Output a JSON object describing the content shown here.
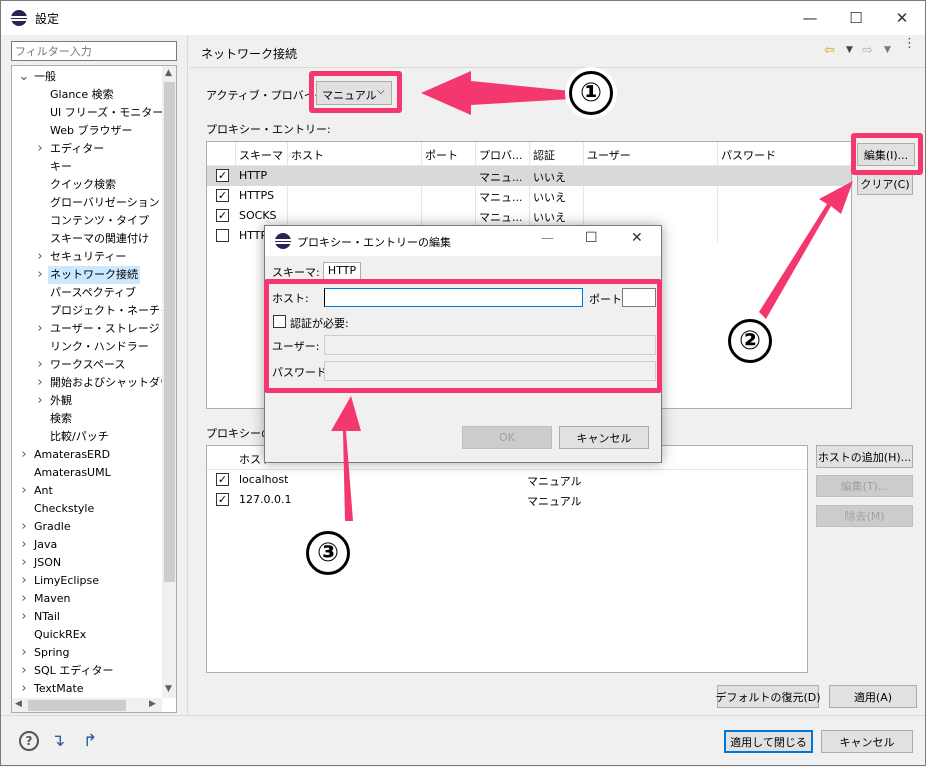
{
  "window": {
    "title": "設定"
  },
  "filter": {
    "placeholder": "フィルター入力"
  },
  "tree": {
    "items": [
      {
        "label": "一般",
        "level": 0,
        "expander": "v"
      },
      {
        "label": "Glance 検索",
        "level": 1,
        "expander": ""
      },
      {
        "label": "UI フリーズ・モニター",
        "level": 1,
        "expander": ""
      },
      {
        "label": "Web ブラウザー",
        "level": 1,
        "expander": ""
      },
      {
        "label": "エディター",
        "level": 1,
        "expander": ">"
      },
      {
        "label": "キー",
        "level": 1,
        "expander": ""
      },
      {
        "label": "クイック検索",
        "level": 1,
        "expander": ""
      },
      {
        "label": "グローバリゼーション",
        "level": 1,
        "expander": ""
      },
      {
        "label": "コンテンツ・タイプ",
        "level": 1,
        "expander": ""
      },
      {
        "label": "スキーマの関連付け",
        "level": 1,
        "expander": ""
      },
      {
        "label": "セキュリティー",
        "level": 1,
        "expander": ">"
      },
      {
        "label": "ネットワーク接続",
        "level": 1,
        "expander": ">",
        "selected": true
      },
      {
        "label": "パースペクティブ",
        "level": 1,
        "expander": ""
      },
      {
        "label": "プロジェクト・ネーチャー",
        "level": 1,
        "expander": ""
      },
      {
        "label": "ユーザー・ストレージ・サー",
        "level": 1,
        "expander": ">"
      },
      {
        "label": "リンク・ハンドラー",
        "level": 1,
        "expander": ""
      },
      {
        "label": "ワークスペース",
        "level": 1,
        "expander": ">"
      },
      {
        "label": "開始およびシャットダウン",
        "level": 1,
        "expander": ">"
      },
      {
        "label": "外観",
        "level": 1,
        "expander": ">"
      },
      {
        "label": "検索",
        "level": 1,
        "expander": ""
      },
      {
        "label": "比較/パッチ",
        "level": 1,
        "expander": ""
      },
      {
        "label": "AmaterasERD",
        "level": 0,
        "expander": ">"
      },
      {
        "label": "AmaterasUML",
        "level": 0,
        "expander": ""
      },
      {
        "label": "Ant",
        "level": 0,
        "expander": ">"
      },
      {
        "label": "Checkstyle",
        "level": 0,
        "expander": ""
      },
      {
        "label": "Gradle",
        "level": 0,
        "expander": ">"
      },
      {
        "label": "Java",
        "level": 0,
        "expander": ">"
      },
      {
        "label": "JSON",
        "level": 0,
        "expander": ">"
      },
      {
        "label": "LimyEclipse",
        "level": 0,
        "expander": ">"
      },
      {
        "label": "Maven",
        "level": 0,
        "expander": ">"
      },
      {
        "label": "NTail",
        "level": 0,
        "expander": ">"
      },
      {
        "label": "QuickREx",
        "level": 0,
        "expander": ""
      },
      {
        "label": "Spring",
        "level": 0,
        "expander": ">"
      },
      {
        "label": "SQL エディター",
        "level": 0,
        "expander": ">"
      },
      {
        "label": "TextMate",
        "level": 0,
        "expander": ">"
      }
    ]
  },
  "page": {
    "title": "ネットワーク接続",
    "active_provider_label": "アクティブ・プロバイダー:",
    "active_provider_value": "マニュアル",
    "proxy_entries_label": "プロキシー・エントリー:",
    "bypass_label": "プロキシーのバ",
    "proxy_columns": [
      "スキーマ",
      "ホスト",
      "ポート",
      "プロバ...",
      "認証",
      "ユーザー",
      "パスワード"
    ],
    "proxy_rows": [
      {
        "checked": true,
        "scheme": "HTTP",
        "provider": "マニュ...",
        "auth": "いいえ"
      },
      {
        "checked": true,
        "scheme": "HTTPS",
        "provider": "マニュ...",
        "auth": "いいえ"
      },
      {
        "checked": true,
        "scheme": "SOCKS",
        "provider": "マニュ...",
        "auth": "いいえ"
      },
      {
        "checked": false,
        "scheme": "HTTP",
        "provider": "",
        "auth": ""
      }
    ],
    "edit_button": "編集(I)...",
    "clear_button": "クリア(C)",
    "bypass_columns": [
      "ホスト"
    ],
    "bypass_rows": [
      {
        "checked": true,
        "host": "localhost",
        "provider": "マニュアル"
      },
      {
        "checked": true,
        "host": "127.0.0.1",
        "provider": "マニュアル"
      }
    ],
    "add_host_button": "ホストの追加(H)...",
    "edit_host_button": "編集(T)...",
    "remove_button": "除去(M)",
    "restore_defaults_button": "デフォルトの復元(D)",
    "apply_button": "適用(A)"
  },
  "footer": {
    "apply_close_button": "適用して閉じる",
    "cancel_button": "キャンセル"
  },
  "dialog": {
    "title": "プロキシー・エントリーの編集",
    "schema_label": "スキーマ:",
    "schema_value": "HTTP",
    "host_label": "ホスト:",
    "host_value": "",
    "port_label": "ポート:",
    "port_value": "",
    "auth_required_label": "認証が必要:",
    "user_label": "ユーザー:",
    "password_label": "パスワード:",
    "ok_button": "OK",
    "cancel_button": "キャンセル"
  },
  "annotations": {
    "step1": "①",
    "step2": "②",
    "step3": "③",
    "accent_color": "#f4376f"
  }
}
